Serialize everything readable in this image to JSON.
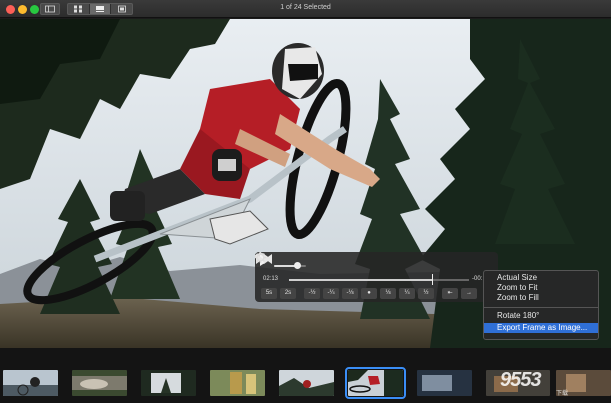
{
  "window": {
    "title": "1 of 24 Selected"
  },
  "toolbar": {
    "sidebar_icon": "sidebar-icon",
    "view_modes": [
      "grid-view-icon",
      "single-view-icon",
      "split-view-icon"
    ],
    "active_mode": 1
  },
  "video_controls": {
    "current_time": "02:13",
    "remaining_time": "-00:",
    "volume": 0.68,
    "progress": 0.8,
    "speeds": [
      "5s",
      "2s",
      "-½",
      "-¼",
      "-⅛",
      "●",
      "⅛",
      "¼",
      "½",
      "⇤",
      "→"
    ]
  },
  "context_menu": {
    "items": [
      "Actual Size",
      "Zoom to Fit",
      "Zoom to Fill",
      "Rotate 180°",
      "Export Frame as Image..."
    ],
    "highlighted": "Export Frame as Image..."
  },
  "filmstrip": {
    "selected_index": 5,
    "thumb_count": 9,
    "watermark": "9553",
    "watermark_sub": "下载"
  },
  "colors": {
    "accent": "#2f6fd6",
    "selection_ring": "#3a8ef6",
    "traffic_close": "#fc5f57",
    "traffic_min": "#fdbb2e",
    "traffic_max": "#28c840"
  }
}
